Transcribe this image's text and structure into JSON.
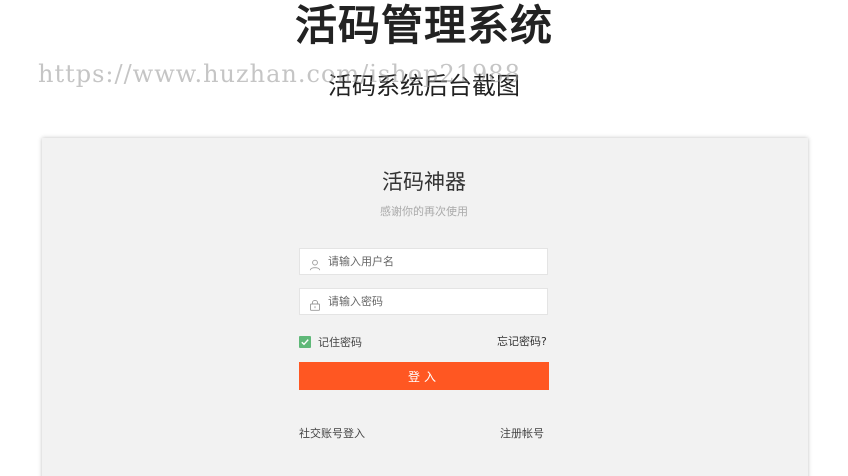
{
  "header": {
    "title": "活码管理系统",
    "subtitle": "活码系统后台截图",
    "watermark": "https://www.huzhan.com/ishop21988"
  },
  "login": {
    "brand_title": "活码神器",
    "brand_subtitle": "感谢你的再次使用",
    "username_placeholder": "请输入用户名",
    "password_placeholder": "请输入密码",
    "remember_label": "记住密码",
    "remember_checked": true,
    "forgot_label": "忘记密码?",
    "login_label": "登入",
    "social_login_label": "社交账号登入",
    "register_label": "注册帐号"
  },
  "colors": {
    "accent": "#ff5722",
    "checkbox": "#5fb878",
    "panel_bg": "#f2f2f2"
  },
  "icons": {
    "username": "user-icon",
    "password": "lock-icon"
  }
}
